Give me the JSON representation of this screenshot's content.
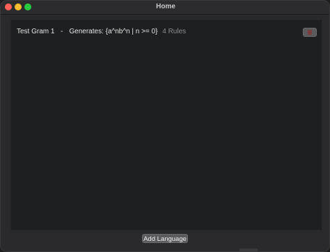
{
  "window": {
    "title": "Home"
  },
  "languages": [
    {
      "name": "Test Gram 1",
      "separator": "-",
      "generates": "Generates: {a^nb^n | n >= 0}",
      "rules": "4 Rules"
    }
  ],
  "footer": {
    "add_label": "Add Language"
  },
  "colors": {
    "close": "#ff5f57",
    "minimize": "#febc2e",
    "maximize": "#28c840",
    "delete_icon": "#7a3e3e"
  },
  "icons": {
    "delete": "trash-icon"
  }
}
